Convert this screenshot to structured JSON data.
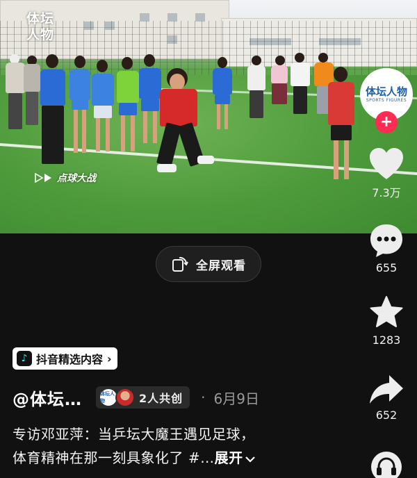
{
  "video": {
    "watermark_top_left": [
      "体坛",
      "人物"
    ],
    "watermark_bottom": "点球大战",
    "avatar_text": "体坛人物",
    "avatar_subtext": "SPORTS FIGURES"
  },
  "fullscreen": {
    "label": "全屏观看",
    "icon": "rotate-screen-icon"
  },
  "actions": {
    "likes": "7.3万",
    "comments": "655",
    "favorites": "1283",
    "shares": "652"
  },
  "tag": {
    "label": "抖音精选内容",
    "chevron": "›",
    "logo": "♪"
  },
  "author": {
    "name": "@体坛…",
    "cocreate_label": "2人共创",
    "separator": "·",
    "date": "6月9日",
    "mini_avatar_text": "体坛人物"
  },
  "description": {
    "line1": "专访邓亚萍：当乒坛大魔王遇见足球，",
    "line2": "体育精神在那一刻具象化了 #…",
    "expand": "展开",
    "expand_icon": "chevron-down-icon"
  },
  "colors": {
    "follow": "#fe2c55",
    "background": "#111111",
    "tag_logo_accent": "#25f4ee"
  }
}
